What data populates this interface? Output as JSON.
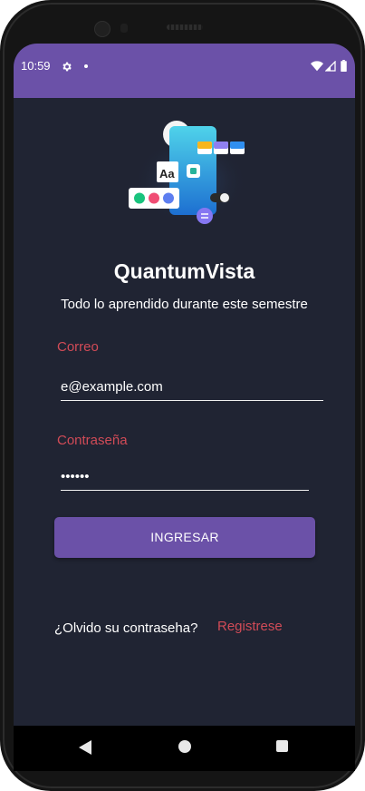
{
  "status_bar": {
    "time": "10:59",
    "icons": [
      "gear-icon",
      "dot-icon",
      "wifi-icon",
      "signal-icon",
      "battery-icon"
    ]
  },
  "illustration": {
    "icon": "app-illustration",
    "text_tile": "Aa"
  },
  "app": {
    "title": "QuantumVista",
    "subtitle": "Todo lo aprendido durante este semestre"
  },
  "form": {
    "email_label": "Correo",
    "email_value": "e@example.com",
    "password_label": "Contraseña",
    "password_value": "••••••",
    "submit_label": "INGRESAR"
  },
  "links": {
    "forgot": "¿Olvido su contraseha?",
    "register": "Registrese"
  },
  "navigation": {
    "icons": [
      "back-icon",
      "home-icon",
      "recents-icon"
    ]
  },
  "colors": {
    "accent": "#6b51a8",
    "background": "#202433",
    "label": "#d14b57",
    "text": "#ffffff"
  }
}
